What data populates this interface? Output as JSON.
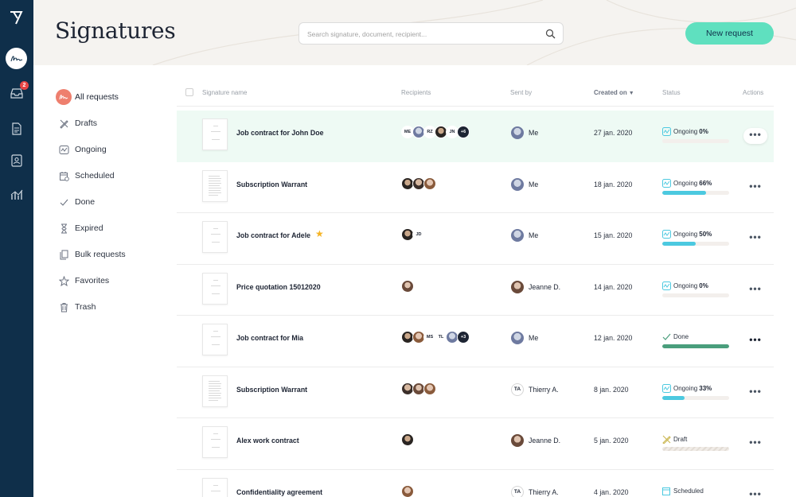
{
  "header": {
    "title": "Signatures",
    "search_placeholder": "Search signature, document, recipient...",
    "new_request_label": "New request"
  },
  "rail": {
    "inbox_badge": "2"
  },
  "nav": {
    "items": [
      {
        "label": "All requests",
        "icon": "signature-icon"
      },
      {
        "label": "Drafts",
        "icon": "pencil-cross-icon"
      },
      {
        "label": "Ongoing",
        "icon": "ongoing-icon"
      },
      {
        "label": "Scheduled",
        "icon": "calendar-icon"
      },
      {
        "label": "Done",
        "icon": "check-icon"
      },
      {
        "label": "Expired",
        "icon": "hourglass-icon"
      },
      {
        "label": "Bulk requests",
        "icon": "copies-icon"
      },
      {
        "label": "Favorites",
        "icon": "star-icon"
      },
      {
        "label": "Trash",
        "icon": "trash-icon"
      }
    ]
  },
  "table": {
    "columns": {
      "name": "Signature name",
      "recipients": "Recipients",
      "sent_by": "Sent by",
      "created_on": "Created on",
      "status": "Status",
      "actions": "Actions"
    },
    "rows": [
      {
        "name": "Job contract for John Doe",
        "recipients": [
          "ME",
          "",
          "RZ",
          "",
          "JN",
          "+6"
        ],
        "sent_by": "Me",
        "created": "27 jan. 2020",
        "status": "Ongoing",
        "pct": "0%",
        "progress": 0
      },
      {
        "name": "Subscription Warrant",
        "recipients": [
          "",
          "",
          ""
        ],
        "sent_by": "Me",
        "created": "18 jan. 2020",
        "status": "Ongoing",
        "pct": "66%",
        "progress": 0.66
      },
      {
        "name": "Job contract for Adele",
        "recipients": [
          "",
          "JD"
        ],
        "sent_by": "Me",
        "created": "15 jan. 2020",
        "status": "Ongoing",
        "pct": "50%",
        "progress": 0.5
      },
      {
        "name": "Price quotation 15012020",
        "recipients": [
          ""
        ],
        "sent_by": "Jeanne D.",
        "created": "14 jan. 2020",
        "status": "Ongoing",
        "pct": "0%",
        "progress": 0
      },
      {
        "name": "Job contract for Mia",
        "recipients": [
          "",
          "",
          "MS",
          "TL",
          "",
          "+3"
        ],
        "sent_by": "Me",
        "created": "12 jan. 2020",
        "status": "Done",
        "pct": "",
        "progress": 1
      },
      {
        "name": "Subscription Warrant",
        "recipients": [
          "",
          "",
          ""
        ],
        "sent_by": "Thierry A.",
        "sent_by_initials": "TA",
        "created": "8 jan. 2020",
        "status": "Ongoing",
        "pct": "33%",
        "progress": 0.33
      },
      {
        "name": "Alex work contract",
        "recipients": [
          ""
        ],
        "sent_by": "Jeanne D.",
        "created": "5 jan. 2020",
        "status": "Draft",
        "pct": "",
        "progress": 0
      },
      {
        "name": "Confidentiality agreement",
        "recipients": [
          ""
        ],
        "sent_by": "Thierry A.",
        "sent_by_initials": "TA",
        "created": "4 jan. 2020",
        "status": "Scheduled",
        "pct": "",
        "progress": 0
      }
    ]
  },
  "colors": {
    "accent": "#5fe0bf",
    "rail": "#0f2f4a",
    "progress": "#4cc9e0",
    "done": "#4a9e7c",
    "active_nav": "#ee7f6e"
  }
}
